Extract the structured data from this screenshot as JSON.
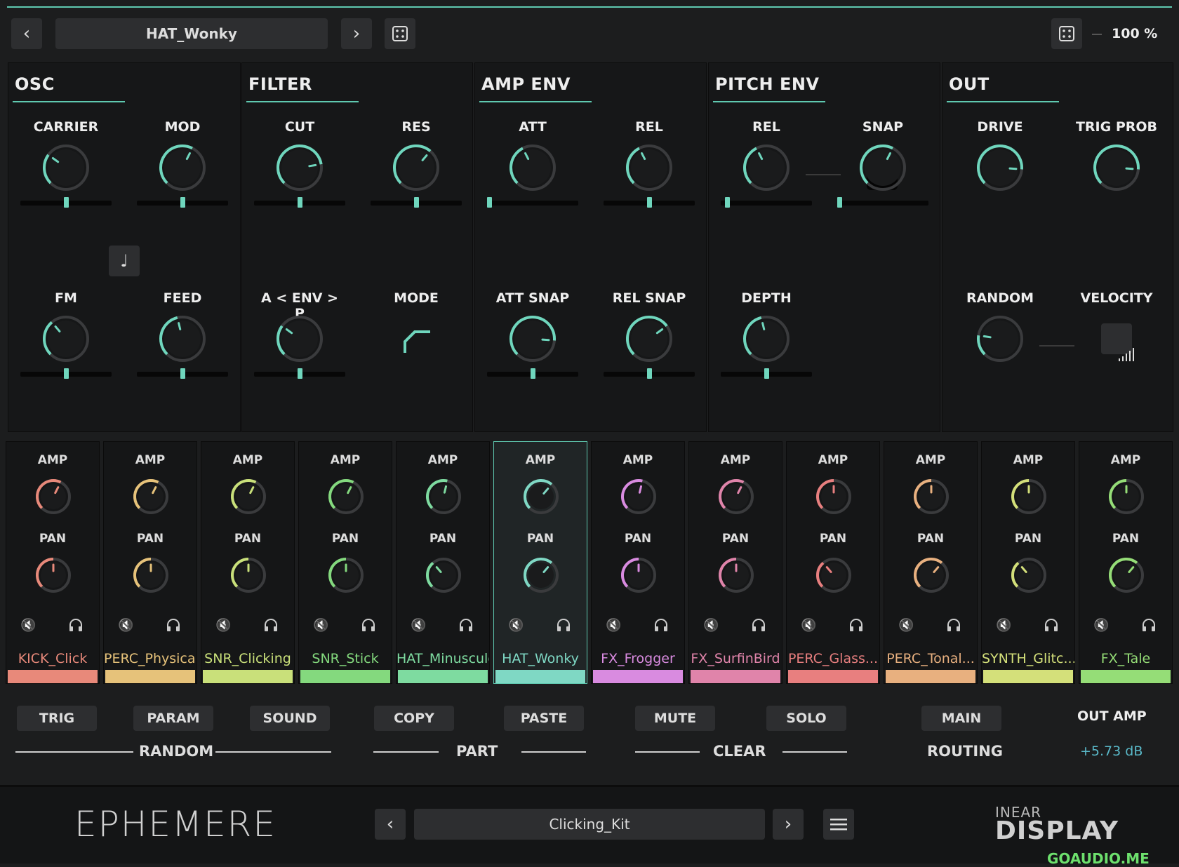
{
  "header": {
    "preset": "HAT_Wonky",
    "zoom": "100 %"
  },
  "panels": [
    {
      "title": "OSC",
      "knobs": [
        {
          "label": "CARRIER",
          "value": 0.3,
          "slider": 0.5
        },
        {
          "label": "MOD",
          "value": 0.6,
          "slider": 0.5
        },
        {
          "label": "FM",
          "value": 0.35,
          "slider": 0.5
        },
        {
          "label": "FEED",
          "value": 0.45,
          "slider": 0.5
        }
      ]
    },
    {
      "title": "FILTER",
      "knobs": [
        {
          "label": "CUT",
          "value": 0.8,
          "slider": 0.5
        },
        {
          "label": "RES",
          "value": 0.65,
          "slider": 0.5
        },
        {
          "label": "A < ENV > P",
          "value": 0.3,
          "slider": 0.5
        }
      ],
      "mode_label": "MODE"
    },
    {
      "title": "AMP ENV",
      "knobs": [
        {
          "label": "ATT",
          "value": 0.4,
          "slider": 0.0
        },
        {
          "label": "REL",
          "value": 0.4,
          "slider": 0.5
        },
        {
          "label": "ATT SNAP",
          "value": 0.85,
          "slider": 0.5
        },
        {
          "label": "REL SNAP",
          "value": 0.7,
          "slider": 0.5
        }
      ]
    },
    {
      "title": "PITCH ENV",
      "knobs": [
        {
          "label": "REL",
          "value": 0.4,
          "slider": 0.05
        },
        {
          "label": "SNAP",
          "value": 0.6,
          "slider": 0.0
        },
        {
          "label": "DEPTH",
          "value": 0.45,
          "slider": 0.5
        }
      ]
    },
    {
      "title": "OUT",
      "knobs": [
        {
          "label": "DRIVE",
          "value": 0.85,
          "slider": null
        },
        {
          "label": "TRIG PROB",
          "value": 0.85,
          "slider": null
        },
        {
          "label": "RANDOM",
          "value": 0.2,
          "slider": null
        }
      ],
      "velocity_label": "VELOCITY"
    }
  ],
  "channels": [
    {
      "amp_label": "AMP",
      "pan_label": "PAN",
      "name": "KICK_Click",
      "color": "#e8897a",
      "amp": 0.6,
      "pan": 0.5
    },
    {
      "amp_label": "AMP",
      "pan_label": "PAN",
      "name": "PERC_Physical",
      "color": "#e6c27a",
      "amp": 0.6,
      "pan": 0.5
    },
    {
      "amp_label": "AMP",
      "pan_label": "PAN",
      "name": "SNR_Clicking",
      "color": "#c9e07a",
      "amp": 0.6,
      "pan": 0.5
    },
    {
      "amp_label": "AMP",
      "pan_label": "PAN",
      "name": "SNR_Stick",
      "color": "#84d97e",
      "amp": 0.6,
      "pan": 0.5
    },
    {
      "amp_label": "AMP",
      "pan_label": "PAN",
      "name": "HAT_Minuscule",
      "color": "#7edba0",
      "amp": 0.55,
      "pan": 0.35
    },
    {
      "amp_label": "AMP",
      "pan_label": "PAN",
      "name": "HAT_Wonky",
      "color": "#7fd8c4",
      "amp": 0.65,
      "pan": 0.65
    },
    {
      "amp_label": "AMP",
      "pan_label": "PAN",
      "name": "FX_Frogger",
      "color": "#d98be0",
      "amp": 0.55,
      "pan": 0.5
    },
    {
      "amp_label": "AMP",
      "pan_label": "PAN",
      "name": "FX_SurfinBird",
      "color": "#e084aa",
      "amp": 0.6,
      "pan": 0.5
    },
    {
      "amp_label": "AMP",
      "pan_label": "PAN",
      "name": "PERC_Glass...",
      "color": "#e87f7f",
      "amp": 0.5,
      "pan": 0.35
    },
    {
      "amp_label": "AMP",
      "pan_label": "PAN",
      "name": "PERC_Tonal...",
      "color": "#e8b07f",
      "amp": 0.5,
      "pan": 0.65
    },
    {
      "amp_label": "AMP",
      "pan_label": "PAN",
      "name": "SYNTH_Glitc...",
      "color": "#d4e07a",
      "amp": 0.5,
      "pan": 0.35
    },
    {
      "amp_label": "AMP",
      "pan_label": "PAN",
      "name": "FX_Tale",
      "color": "#95dd77",
      "amp": 0.5,
      "pan": 0.65
    }
  ],
  "actions": {
    "random": {
      "trig": "TRIG",
      "param": "PARAM",
      "sound": "SOUND",
      "label": "RANDOM"
    },
    "part": {
      "copy": "COPY",
      "paste": "PASTE",
      "label": "PART"
    },
    "clear": {
      "mute": "MUTE",
      "solo": "SOLO",
      "label": "CLEAR"
    },
    "routing": {
      "main": "MAIN",
      "label": "ROUTING"
    },
    "out_amp": {
      "label": "OUT AMP",
      "value": "+5.73 dB"
    }
  },
  "footer": {
    "logo": "EPHEMERE",
    "kit": "Clicking_Kit",
    "brand_top": "INEAR",
    "brand_bottom": "DISPLAY",
    "watermark": "GOAUDIO.ME"
  },
  "colors": {
    "accent": "#5fc9b0",
    "out_amp": "#5ab9c9"
  }
}
